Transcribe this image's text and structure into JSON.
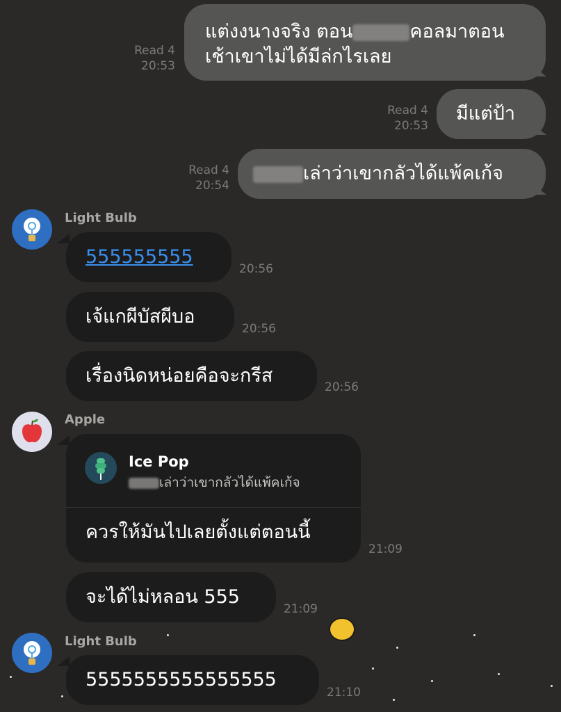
{
  "messages": {
    "out1": {
      "line1_a": "แต่งงนางจริง ตอน",
      "line1_b": "คอลมาตอน",
      "line2": "เช้าเขาไม่ได้มีล่กไรเลย",
      "read": "Read 4",
      "time": "20:53"
    },
    "out2": {
      "text": "มีแต่ป้า",
      "read": "Read 4",
      "time": "20:53"
    },
    "out3": {
      "text": "เล่าว่าเขากลัวได้แพ้คเก้จ",
      "read": "Read 4",
      "time": "20:54"
    },
    "group1": {
      "sender": "Light Bulb",
      "msg1": {
        "text": "555555555",
        "time": "20:56"
      },
      "msg2": {
        "text": "เจ้แกผีบัสผีบอ",
        "time": "20:56"
      },
      "msg3": {
        "text": "เรื่องนิดหน่อยคือจะกรีส",
        "time": "20:56"
      }
    },
    "group2": {
      "sender": "Apple",
      "reply": {
        "name": "Ice Pop",
        "quote": "เล่าว่าเขากลัวได้แพ้คเก้จ"
      },
      "msg1": {
        "text": "ควรให้มันไปเลยตั้งแต่ตอนนี้",
        "time": "21:09"
      },
      "msg2": {
        "text": "จะได้ไม่หลอน 555",
        "time": "21:09"
      }
    },
    "group3": {
      "sender": "Light Bulb",
      "msg1": {
        "text": "5555555555555555",
        "time": "21:10"
      }
    }
  },
  "icons": {
    "light_bulb_avatar": "light-bulb-avatar",
    "apple_avatar": "apple-avatar",
    "ice_pop_avatar": "ice-pop-avatar"
  },
  "colors": {
    "background": "#2a2927",
    "outgoing_bubble": "#555553",
    "incoming_bubble": "#1c1c1c",
    "link": "#3a8ff0",
    "meta_text": "#7c7a77"
  }
}
